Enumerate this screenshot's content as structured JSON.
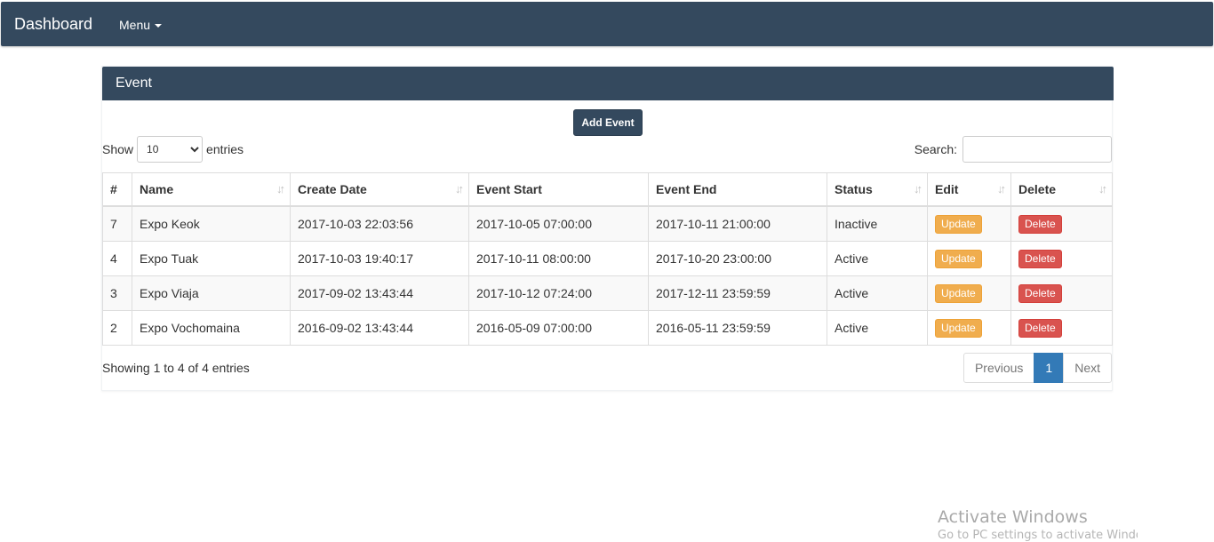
{
  "navbar": {
    "brand": "Dashboard",
    "menu_label": "Menu"
  },
  "panel": {
    "title": "Event",
    "add_button": "Add Event",
    "length": {
      "show_label": "Show",
      "selected": "10",
      "entries_label": "entries"
    },
    "search_label": "Search:",
    "table": {
      "headers": [
        "#",
        "Name",
        "Create Date",
        "Event Start",
        "Event End",
        "Status",
        "Edit",
        "Delete"
      ],
      "rows": [
        {
          "id": "7",
          "name": "Expo Keok",
          "create_date": "2017-10-03 22:03:56",
          "event_start": "2017-10-05 07:00:00",
          "event_end": "2017-10-11 21:00:00",
          "status": "Inactive",
          "edit_label": "Update",
          "delete_label": "Delete"
        },
        {
          "id": "4",
          "name": "Expo Tuak",
          "create_date": "2017-10-03 19:40:17",
          "event_start": "2017-10-11 08:00:00",
          "event_end": "2017-10-20 23:00:00",
          "status": "Active",
          "edit_label": "Update",
          "delete_label": "Delete"
        },
        {
          "id": "3",
          "name": "Expo Viaja",
          "create_date": "2017-09-02 13:43:44",
          "event_start": "2017-10-12 07:24:00",
          "event_end": "2017-12-11 23:59:59",
          "status": "Active",
          "edit_label": "Update",
          "delete_label": "Delete"
        },
        {
          "id": "2",
          "name": "Expo Vochomaina",
          "create_date": "2016-09-02 13:43:44",
          "event_start": "2016-05-09 07:00:00",
          "event_end": "2016-05-11 23:59:59",
          "status": "Active",
          "edit_label": "Update",
          "delete_label": "Delete"
        }
      ]
    },
    "info": "Showing 1 to 4 of 4 entries",
    "pagination": {
      "previous": "Previous",
      "current": "1",
      "next": "Next"
    }
  },
  "watermark": {
    "title": "Activate Windows",
    "subtitle": "Go to PC settings to activate Windows."
  },
  "colors": {
    "navbar": "#34495e",
    "update_button": "#f0ad4e",
    "delete_button": "#d9534f",
    "active_page": "#337ab7"
  }
}
